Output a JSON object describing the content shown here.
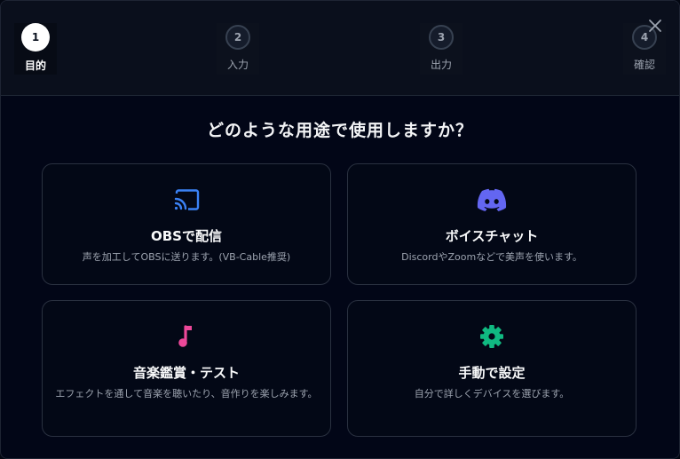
{
  "steps": [
    {
      "number": "1",
      "label": "目的"
    },
    {
      "number": "2",
      "label": "入力"
    },
    {
      "number": "3",
      "label": "出力"
    },
    {
      "number": "4",
      "label": "確認"
    }
  ],
  "question": "どのような用途で使用しますか？",
  "cards": [
    {
      "icon": "cast-icon",
      "title": "OBSで配信",
      "description": "声を加工してOBSに送ります。(VB-Cable推奨)",
      "icon_color": "#3b82f6"
    },
    {
      "icon": "discord-icon",
      "title": "ボイスチャット",
      "description": "DiscordやZoomなどで美声を使います。",
      "icon_color": "#6366f1"
    },
    {
      "icon": "music-note-icon",
      "title": "音楽鑑賞・テスト",
      "description": "エフェクトを通して音楽を聴いたり、音作りを楽しみます。",
      "icon_color": "#ec4899"
    },
    {
      "icon": "gear-icon",
      "title": "手動で設定",
      "description": "自分で詳しくデバイスを選びます。",
      "icon_color": "#10b981"
    }
  ]
}
